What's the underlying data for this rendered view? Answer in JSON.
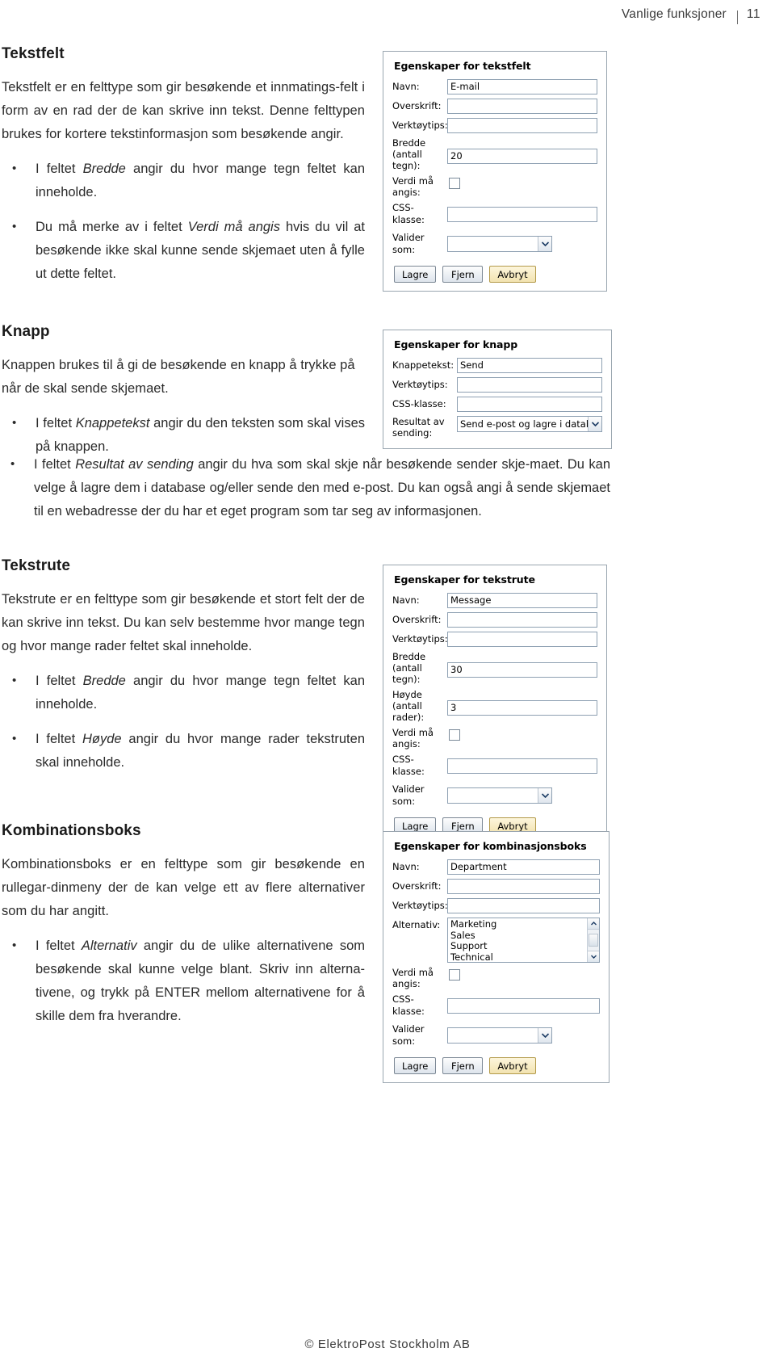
{
  "header": {
    "title": "Vanlige funksjoner",
    "page_number": "11"
  },
  "footer": {
    "copyright": "© ElektroPost Stockholm AB"
  },
  "sections": [
    {
      "id": "tekstfelt",
      "title": "Tekstfelt",
      "intro": "Tekstfelt er en felttype som gir besøkende et innmatings-felt i form av en rad der de kan skrive inn tekst. Denne felttypen brukes for kortere tekstinformasjon som besøkende angir.",
      "bullets": [
        {
          "pre": "I feltet ",
          "em": "Bredde",
          "post": " angir du hvor mange tegn feltet kan inneholde."
        },
        {
          "pre": "Du må merke av i feltet ",
          "em": "Verdi må angis",
          "post": " hvis du vil at besøkende ikke skal kunne sende skjemaet uten å fylle ut dette feltet."
        }
      ]
    },
    {
      "id": "knapp",
      "title": "Knapp",
      "intro": "Knappen brukes til å gi de besøkende en knapp å trykke på når de skal sende skjemaet.",
      "bullets": [
        {
          "pre": "I feltet ",
          "em": "Knappetekst",
          "post": " angir du den teksten som skal vises på knappen."
        },
        {
          "pre": "I feltet ",
          "em": "Resultat av sending",
          "post": " angir du hva som skal skje når besøkende sender skje-maet. Du kan velge å lagre dem i database og/eller sende den med e-post. Du kan også angi å sende skjemaet til en webadresse der du har et eget program som tar seg av informasjonen."
        }
      ]
    },
    {
      "id": "tekstrute",
      "title": "Tekstrute",
      "intro": "Tekstrute er en felttype som gir besøkende et stort felt der de kan skrive inn tekst. Du kan selv bestemme hvor mange tegn og hvor mange rader feltet skal inneholde.",
      "bullets": [
        {
          "pre": "I feltet ",
          "em": "Bredde",
          "post": " angir du hvor mange tegn feltet kan inneholde."
        },
        {
          "pre": "I feltet ",
          "em": "Høyde",
          "post": " angir du hvor mange rader tekstruten skal inneholde."
        }
      ]
    },
    {
      "id": "kombinasjonsboks",
      "title": "Kombinationsboks",
      "intro": "Kombinationsboks er en felttype som gir besøkende en rullegar-dinmeny der de kan velge ett av flere alternativer som du har angitt.",
      "bullets": [
        {
          "pre": "I feltet ",
          "em": "Alternativ",
          "post": " angir du de ulike alternativene som besøkende skal kunne velge blant. Skriv inn alterna-tivene, og trykk på ENTER mellom alternativene for å skille dem fra hverandre."
        }
      ]
    }
  ],
  "dialogs": {
    "tekstfelt": {
      "title": "Egenskaper for tekstfelt",
      "fields": [
        {
          "label": "Navn:",
          "value": "E-mail",
          "type": "text"
        },
        {
          "label": "Overskrift:",
          "value": "",
          "type": "text"
        },
        {
          "label": "Verktøytips:",
          "value": "",
          "type": "text"
        },
        {
          "label": "Bredde\n(antall\ntegn):",
          "value": "20",
          "type": "text"
        },
        {
          "label": "Verdi må\nangis:",
          "value": "",
          "type": "checkbox"
        },
        {
          "label": "CSS-klasse:",
          "value": "",
          "type": "text"
        },
        {
          "label": "Valider som:",
          "value": "",
          "type": "select"
        }
      ],
      "buttons": [
        "Lagre",
        "Fjern",
        "Avbryt"
      ]
    },
    "knapp": {
      "title": "Egenskaper for knapp",
      "fields": [
        {
          "label": "Knappetekst:",
          "value": "Send",
          "type": "text"
        },
        {
          "label": "Verktøytips:",
          "value": "",
          "type": "text"
        },
        {
          "label": "CSS-klasse:",
          "value": "",
          "type": "text"
        },
        {
          "label": "Resultat av\nsending:",
          "value": "Send e-post og lagre i database",
          "type": "select"
        }
      ],
      "buttons": []
    },
    "tekstrute": {
      "title": "Egenskaper for tekstrute",
      "fields": [
        {
          "label": "Navn:",
          "value": "Message",
          "type": "text"
        },
        {
          "label": "Overskrift:",
          "value": "",
          "type": "text"
        },
        {
          "label": "Verktøytips:",
          "value": "",
          "type": "text"
        },
        {
          "label": "Bredde\n(antall\ntegn):",
          "value": "30",
          "type": "text"
        },
        {
          "label": "Høyde\n(antall\nrader):",
          "value": "3",
          "type": "text"
        },
        {
          "label": "Verdi må\nangis:",
          "value": "",
          "type": "checkbox"
        },
        {
          "label": "CSS-klasse:",
          "value": "",
          "type": "text"
        },
        {
          "label": "Valider som:",
          "value": "",
          "type": "select"
        }
      ],
      "buttons": [
        "Lagre",
        "Fjern",
        "Avbryt"
      ]
    },
    "kombinasjonsboks": {
      "title": "Egenskaper for kombinasjonsboks",
      "fields": [
        {
          "label": "Navn:",
          "value": "Department",
          "type": "text"
        },
        {
          "label": "Overskrift:",
          "value": "",
          "type": "text"
        },
        {
          "label": "Verktøytips:",
          "value": "",
          "type": "text"
        },
        {
          "label": "Alternativ:",
          "value": "",
          "type": "listbox",
          "options": [
            "Marketing",
            "Sales",
            "Support",
            "Technical"
          ]
        },
        {
          "label": "Verdi må\nangis:",
          "value": "",
          "type": "checkbox"
        },
        {
          "label": "CSS-klasse:",
          "value": "",
          "type": "text"
        },
        {
          "label": "Valider som:",
          "value": "",
          "type": "select"
        }
      ],
      "buttons": [
        "Lagre",
        "Fjern",
        "Avbryt"
      ]
    }
  }
}
